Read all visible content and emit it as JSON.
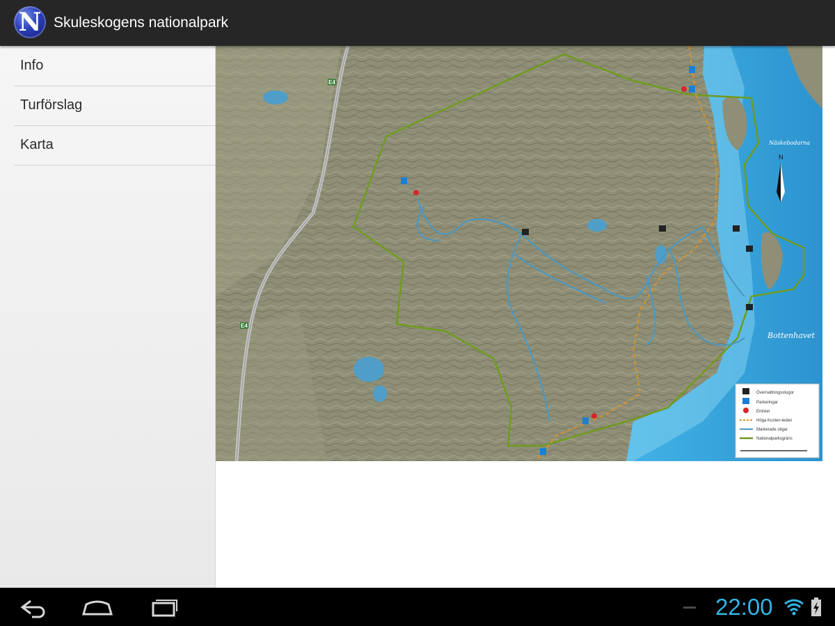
{
  "app": {
    "title": "Skuleskogens nationalpark",
    "logo_letter": "N"
  },
  "drawer": {
    "items": [
      {
        "label": "Info"
      },
      {
        "label": "Turförslag"
      },
      {
        "label": "Karta"
      }
    ]
  },
  "map": {
    "labels": {
      "road": "E4",
      "sea": "Bottenhavet",
      "bay": "Näskebodarna",
      "north": "N"
    },
    "legend": [
      {
        "icon": "cabin-icon",
        "label": "Övernattningsstugor"
      },
      {
        "icon": "parking-icon",
        "label": "Parkeringar"
      },
      {
        "icon": "entrance-icon",
        "label": "Entréer"
      },
      {
        "icon": "orange-dashed-line",
        "label": "Höga Kusten-leden"
      },
      {
        "icon": "blue-line",
        "label": "Markerade stigar"
      },
      {
        "icon": "green-line",
        "label": "Nationalparksgräns"
      }
    ],
    "colors": {
      "land": "#8f8f77",
      "sea": "#3aa8dc",
      "trail": "#4d97bf",
      "boundary": "#6f9b1e",
      "coast_trail": "#d2932f"
    }
  },
  "navbar": {
    "back": "back-icon",
    "home": "home-icon",
    "recent": "recent-apps-icon"
  },
  "status": {
    "time": "22:00",
    "wifi": "wifi-icon",
    "battery": "battery-charging-icon",
    "accent": "#33b5e5"
  }
}
